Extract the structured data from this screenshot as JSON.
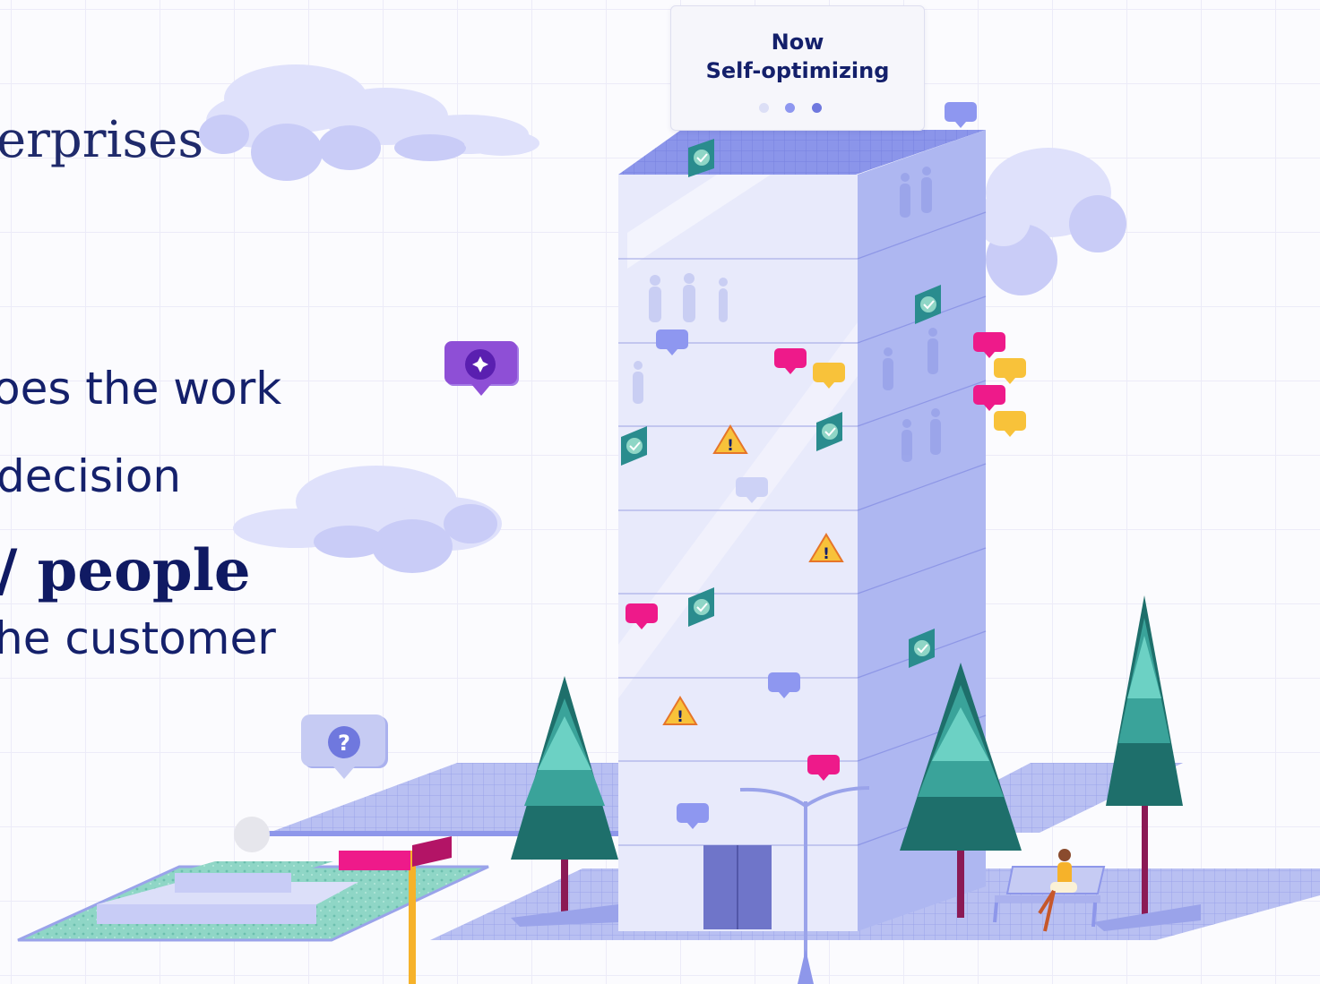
{
  "hero": {
    "heading_fragment": "erprises",
    "line1": "oes the work",
    "line2": "decision",
    "line3_prefix": "/",
    "line3_bold": "people",
    "line4": "he customer"
  },
  "building_tag": {
    "line1": "Now",
    "line2": "Self-optimizing",
    "step_indicator": {
      "total": 3,
      "active": [
        2,
        3
      ]
    }
  },
  "icons": {
    "question": "?",
    "warning": "!"
  },
  "colors": {
    "navy": "#14206b",
    "building_front": "#e6e8fb",
    "building_side": "#aab4f0",
    "pink": "#ee1a8a",
    "yellow": "#f8c23a",
    "periwinkle": "#8e97f0",
    "teal": "#2a8c8e",
    "purple": "#8e4fd6",
    "cloud": "#dfe1fb"
  }
}
